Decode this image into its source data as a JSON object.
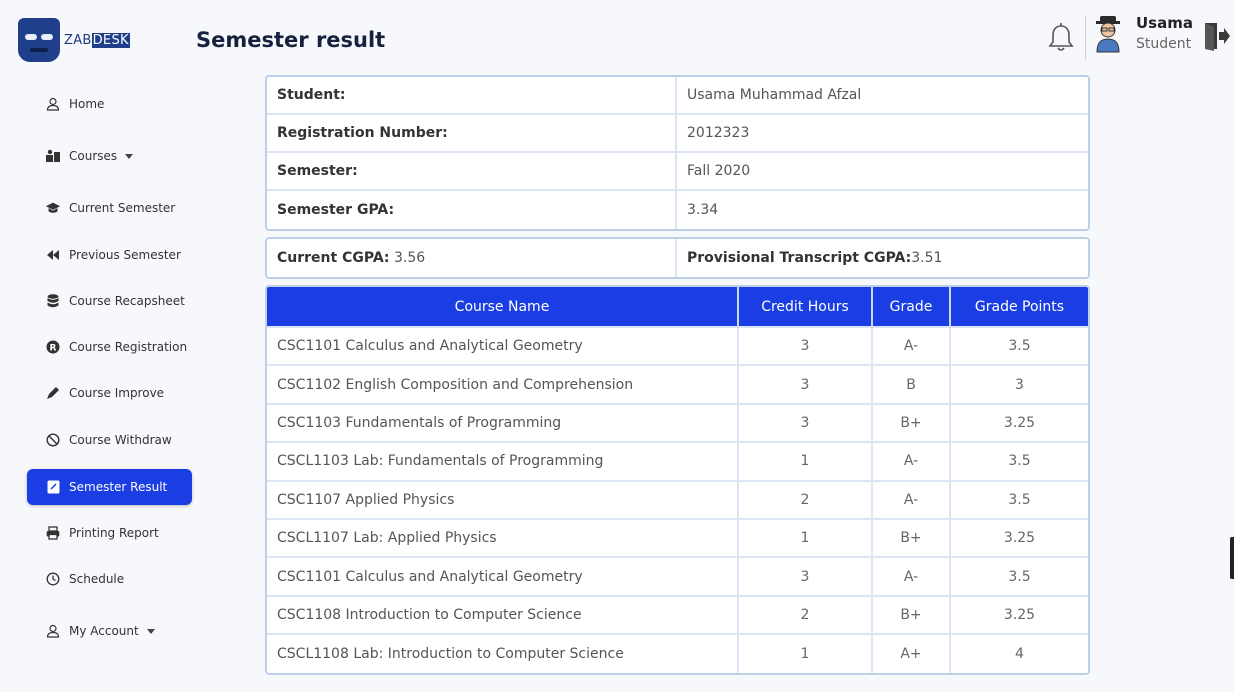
{
  "app": {
    "logo_prefix": "ZAB",
    "logo_suffix": "DESK"
  },
  "header": {
    "title": "Semester result"
  },
  "user": {
    "name": "Usama",
    "role": "Student"
  },
  "sidebar": {
    "items": [
      {
        "label": "Home",
        "icon": "user-icon"
      },
      {
        "label": "Courses",
        "icon": "courses-icon",
        "dropdown": true
      },
      {
        "label": "Current Semester",
        "icon": "graduation-cap-icon"
      },
      {
        "label": "Previous Semester",
        "icon": "backward-icon"
      },
      {
        "label": "Course Recapsheet",
        "icon": "database-icon"
      },
      {
        "label": "Course Registration",
        "icon": "registered-icon"
      },
      {
        "label": "Course Improve",
        "icon": "pen-icon"
      },
      {
        "label": "Course Withdraw",
        "icon": "ban-icon"
      },
      {
        "label": "Semester Result",
        "icon": "result-icon",
        "active": true
      },
      {
        "label": "Printing Report",
        "icon": "printer-icon"
      },
      {
        "label": "Schedule",
        "icon": "clock-icon"
      },
      {
        "label": "My Account",
        "icon": "user-icon",
        "dropdown": true
      }
    ]
  },
  "student_info": {
    "student_label": "Student:",
    "student_value": "Usama Muhammad Afzal",
    "reg_label": "Registration Number:",
    "reg_value": "2012323",
    "semester_label": "Semester:",
    "semester_value": "Fall 2020",
    "gpa_label": "Semester GPA:",
    "gpa_value": "3.34"
  },
  "cgpa": {
    "current_label": "Current CGPA:",
    "current_value": " 3.56",
    "provisional_label": "Provisional Transcript CGPA:",
    "provisional_value": "3.51"
  },
  "courses": {
    "headers": [
      "Course Name",
      "Credit Hours",
      "Grade",
      "Grade Points"
    ],
    "rows": [
      {
        "name": "CSC1101 Calculus and Analytical Geometry",
        "credit": "3",
        "grade": "A-",
        "points": "3.5"
      },
      {
        "name": "CSC1102 English Composition and Comprehension",
        "credit": "3",
        "grade": "B",
        "points": "3"
      },
      {
        "name": "CSC1103 Fundamentals of Programming",
        "credit": "3",
        "grade": "B+",
        "points": "3.25"
      },
      {
        "name": "CSCL1103 Lab: Fundamentals of Programming",
        "credit": "1",
        "grade": "A-",
        "points": "3.5"
      },
      {
        "name": "CSC1107 Applied Physics",
        "credit": "2",
        "grade": "A-",
        "points": "3.5"
      },
      {
        "name": "CSCL1107 Lab: Applied Physics",
        "credit": "1",
        "grade": "B+",
        "points": "3.25"
      },
      {
        "name": "CSC1101 Calculus and Analytical Geometry",
        "credit": "3",
        "grade": "A-",
        "points": "3.5"
      },
      {
        "name": "CSC1108 Introduction to Computer Science",
        "credit": "2",
        "grade": "B+",
        "points": "3.25"
      },
      {
        "name": "CSCL1108 Lab: Introduction to Computer Science",
        "credit": "1",
        "grade": "A+",
        "points": "4"
      }
    ]
  },
  "colors": {
    "accent": "#1a3ee4",
    "border": "#bcd0ea"
  }
}
